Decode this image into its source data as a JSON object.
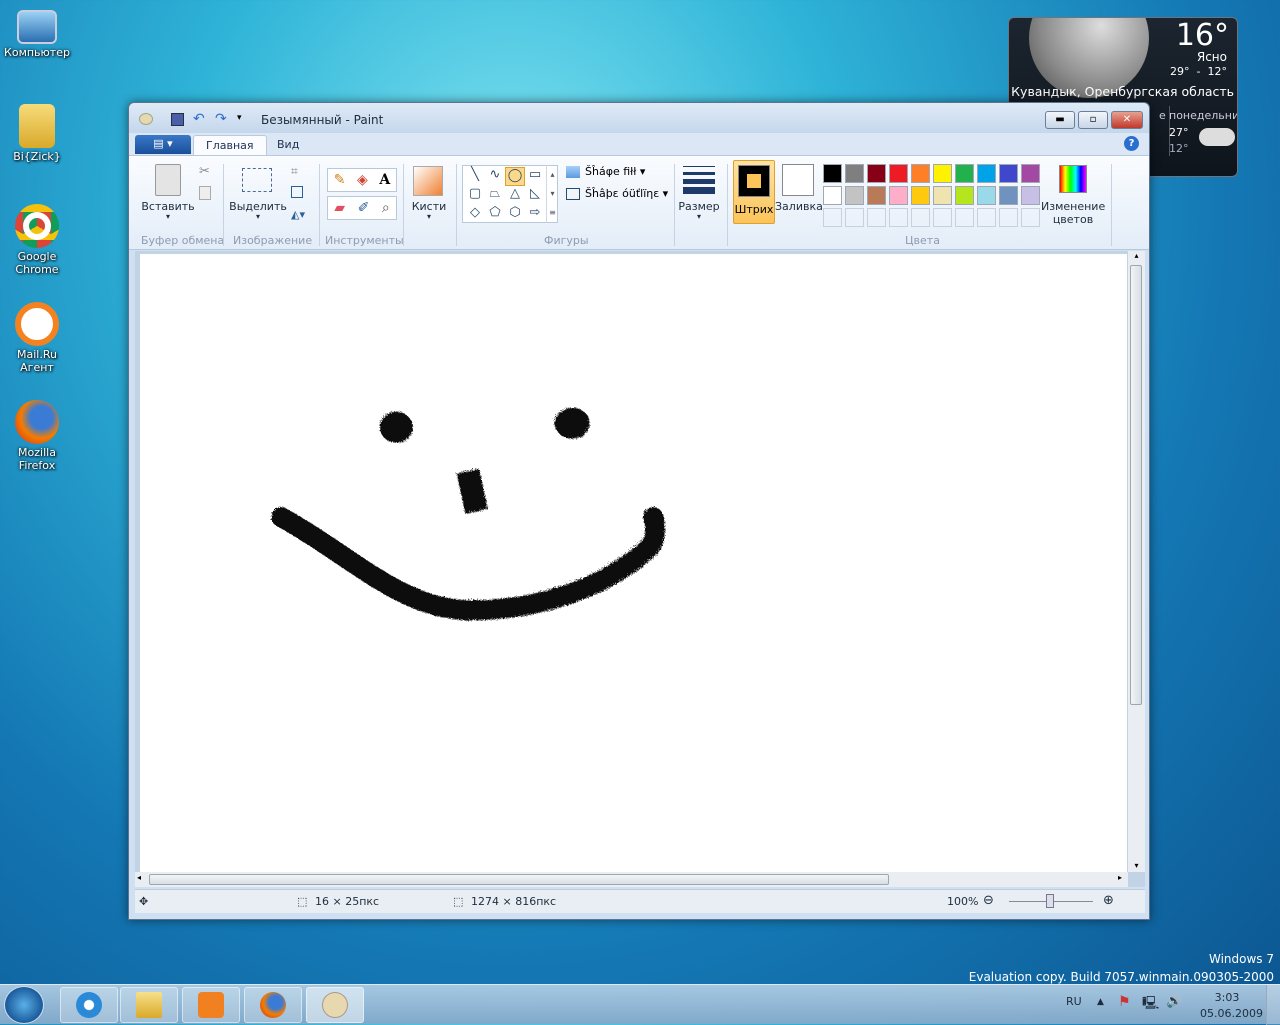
{
  "desktop": {
    "icons": [
      {
        "label": "Компьютер"
      },
      {
        "label": "Bi{Zick}"
      },
      {
        "label": "Google Chrome"
      },
      {
        "label": "Mail.Ru Агент"
      },
      {
        "label": "Mozilla Firefox"
      }
    ],
    "watermark": {
      "line1": "Windows 7",
      "line2": "Evaluation copy. Build 7057.winmain.090305-2000"
    }
  },
  "weather": {
    "temp": "16°",
    "condition": "Ясно",
    "range": "29°  -  12°",
    "location": "Кувандык, Оренбургская область",
    "forecast_day": "понедельник",
    "forecast_high": "27°",
    "forecast_low": "12°",
    "partial_day": "е"
  },
  "window": {
    "title": "Безымянный - Paint",
    "tabs": [
      "Главная",
      "Вид"
    ],
    "groups": {
      "clipboard": "Буфер обмена",
      "image": "Изображение",
      "tools": "Инструменты",
      "shapes": "Фигуры",
      "colors": "Цвета"
    },
    "buttons": {
      "paste": "Вставить",
      "select": "Выделить",
      "brushes": "Кисти",
      "size": "Размер",
      "color1": "Штрих",
      "color2": "Заливка",
      "edit_colors": "Изменение цветов",
      "shape_fill": "Šĥáφe fiłł",
      "shape_outline": "Šĥâþε óüťlïηε"
    },
    "palette_row1": [
      "#000000",
      "#7f7f7f",
      "#880015",
      "#ed1c24",
      "#ff7f27",
      "#fff200",
      "#22b14c",
      "#00a2e8",
      "#3f48cc",
      "#a349a4"
    ],
    "palette_row2": [
      "#ffffff",
      "#c3c3c3",
      "#b97a57",
      "#ffaec9",
      "#ffc90e",
      "#efe4b0",
      "#b5e61d",
      "#99d9ea",
      "#7092be",
      "#c8bfe7"
    ],
    "color1": "#000000",
    "color2": "#ffffff"
  },
  "status": {
    "cursor_size": "16 × 25пкс",
    "image_size": "1274 × 816пкс",
    "zoom": "100%"
  },
  "taskbar": {
    "lang": "RU",
    "time": "3:03",
    "date": "05.06.2009",
    "items": [
      "internet-explorer",
      "explorer",
      "media-player",
      "firefox",
      "paint"
    ]
  }
}
